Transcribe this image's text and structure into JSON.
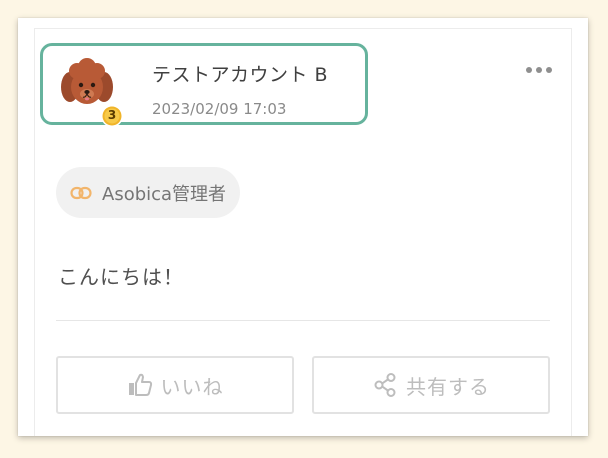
{
  "post": {
    "account_name": "テストアカウント B",
    "timestamp": "2023/02/09 17:03",
    "level": "3",
    "tag_label": "Asobica管理者",
    "body": "こんにちは！"
  },
  "actions": {
    "like_label": "いいね",
    "share_label": "共有する"
  },
  "colors": {
    "background": "#fdf6e5",
    "highlight_border": "#66b39d",
    "badge_gold": "#f0b429",
    "link_icon": "#f2b56b"
  },
  "icons": {
    "more": "more-horizontal-icon",
    "tag": "link-icon",
    "like": "thumbs-up-icon",
    "share": "share-icon",
    "badge": "level-badge-icon"
  }
}
